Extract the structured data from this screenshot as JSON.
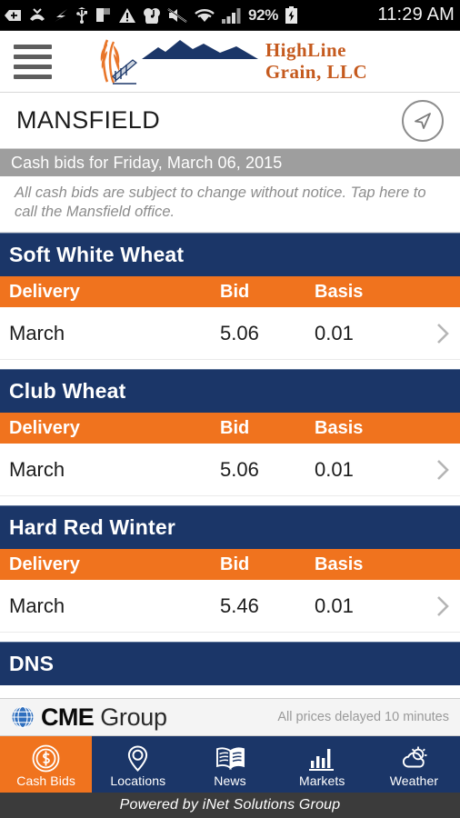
{
  "status_bar": {
    "icons": [
      "back-plus-icon",
      "missed-call-icon",
      "sprint-logo-icon",
      "usb-icon",
      "flag-icon",
      "warning-icon",
      "game-music-icon",
      "mute-icon",
      "wifi-icon",
      "signal-bars-icon"
    ],
    "battery_percent": "92%",
    "battery_icon": "charging-battery-icon",
    "clock": "11:29 AM"
  },
  "header": {
    "menu_icon": "hamburger-menu-icon",
    "logo": {
      "line1": "HighLine",
      "line1_cap": "H",
      "line2": "Grain, LLC",
      "alt": "HighLine Grain, LLC"
    }
  },
  "location": {
    "title": "MANSFIELD",
    "nav_icon": "navigation-arrow-icon"
  },
  "date_bar": {
    "text": "Cash bids for Friday, March 06, 2015"
  },
  "disclaimer": {
    "text": "All cash bids are subject to change without notice. Tap here to call the Mansfield office."
  },
  "columns": {
    "delivery": "Delivery",
    "bid": "Bid",
    "basis": "Basis"
  },
  "commodities": [
    {
      "name": "Soft White Wheat",
      "rows": [
        {
          "delivery": "March",
          "bid": "5.06",
          "basis": "0.01"
        }
      ]
    },
    {
      "name": "Club Wheat",
      "rows": [
        {
          "delivery": "March",
          "bid": "5.06",
          "basis": "0.01"
        }
      ]
    },
    {
      "name": "Hard Red Winter",
      "rows": [
        {
          "delivery": "March",
          "bid": "5.46",
          "basis": "0.01"
        }
      ]
    },
    {
      "name": "DNS",
      "rows": []
    }
  ],
  "cme": {
    "brand_bold": "CME",
    "brand_light": "Group",
    "globe_icon": "cme-globe-icon",
    "delay_note": "All prices delayed 10 minutes"
  },
  "tabs": [
    {
      "label": "Cash Bids",
      "icon": "dollar-coin-icon",
      "active": true
    },
    {
      "label": "Locations",
      "icon": "map-pin-icon",
      "active": false
    },
    {
      "label": "News",
      "icon": "open-book-icon",
      "active": false
    },
    {
      "label": "Markets",
      "icon": "bar-chart-icon",
      "active": false
    },
    {
      "label": "Weather",
      "icon": "sun-cloud-icon",
      "active": false
    }
  ],
  "footer": {
    "text": "Powered by iNet Solutions Group"
  },
  "colors": {
    "navy": "#1b3668",
    "orange": "#f0731e",
    "logo_orange": "#c55a1e",
    "grey_bar": "#9e9e9e",
    "footer_grey": "#3b3b3b"
  }
}
